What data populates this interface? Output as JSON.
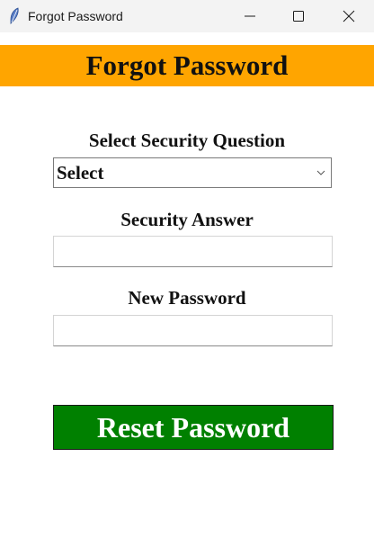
{
  "window": {
    "title": "Forgot Password",
    "icon": "feather-icon"
  },
  "header": {
    "title": "Forgot Password",
    "background": "#ffa500"
  },
  "form": {
    "question_label": "Select Security Question",
    "question_select": {
      "selected": "Select"
    },
    "answer_label": "Security Answer",
    "answer_value": "",
    "password_label": "New Password",
    "password_value": "",
    "reset_button_label": "Reset Password",
    "reset_button_color": "#008000"
  }
}
